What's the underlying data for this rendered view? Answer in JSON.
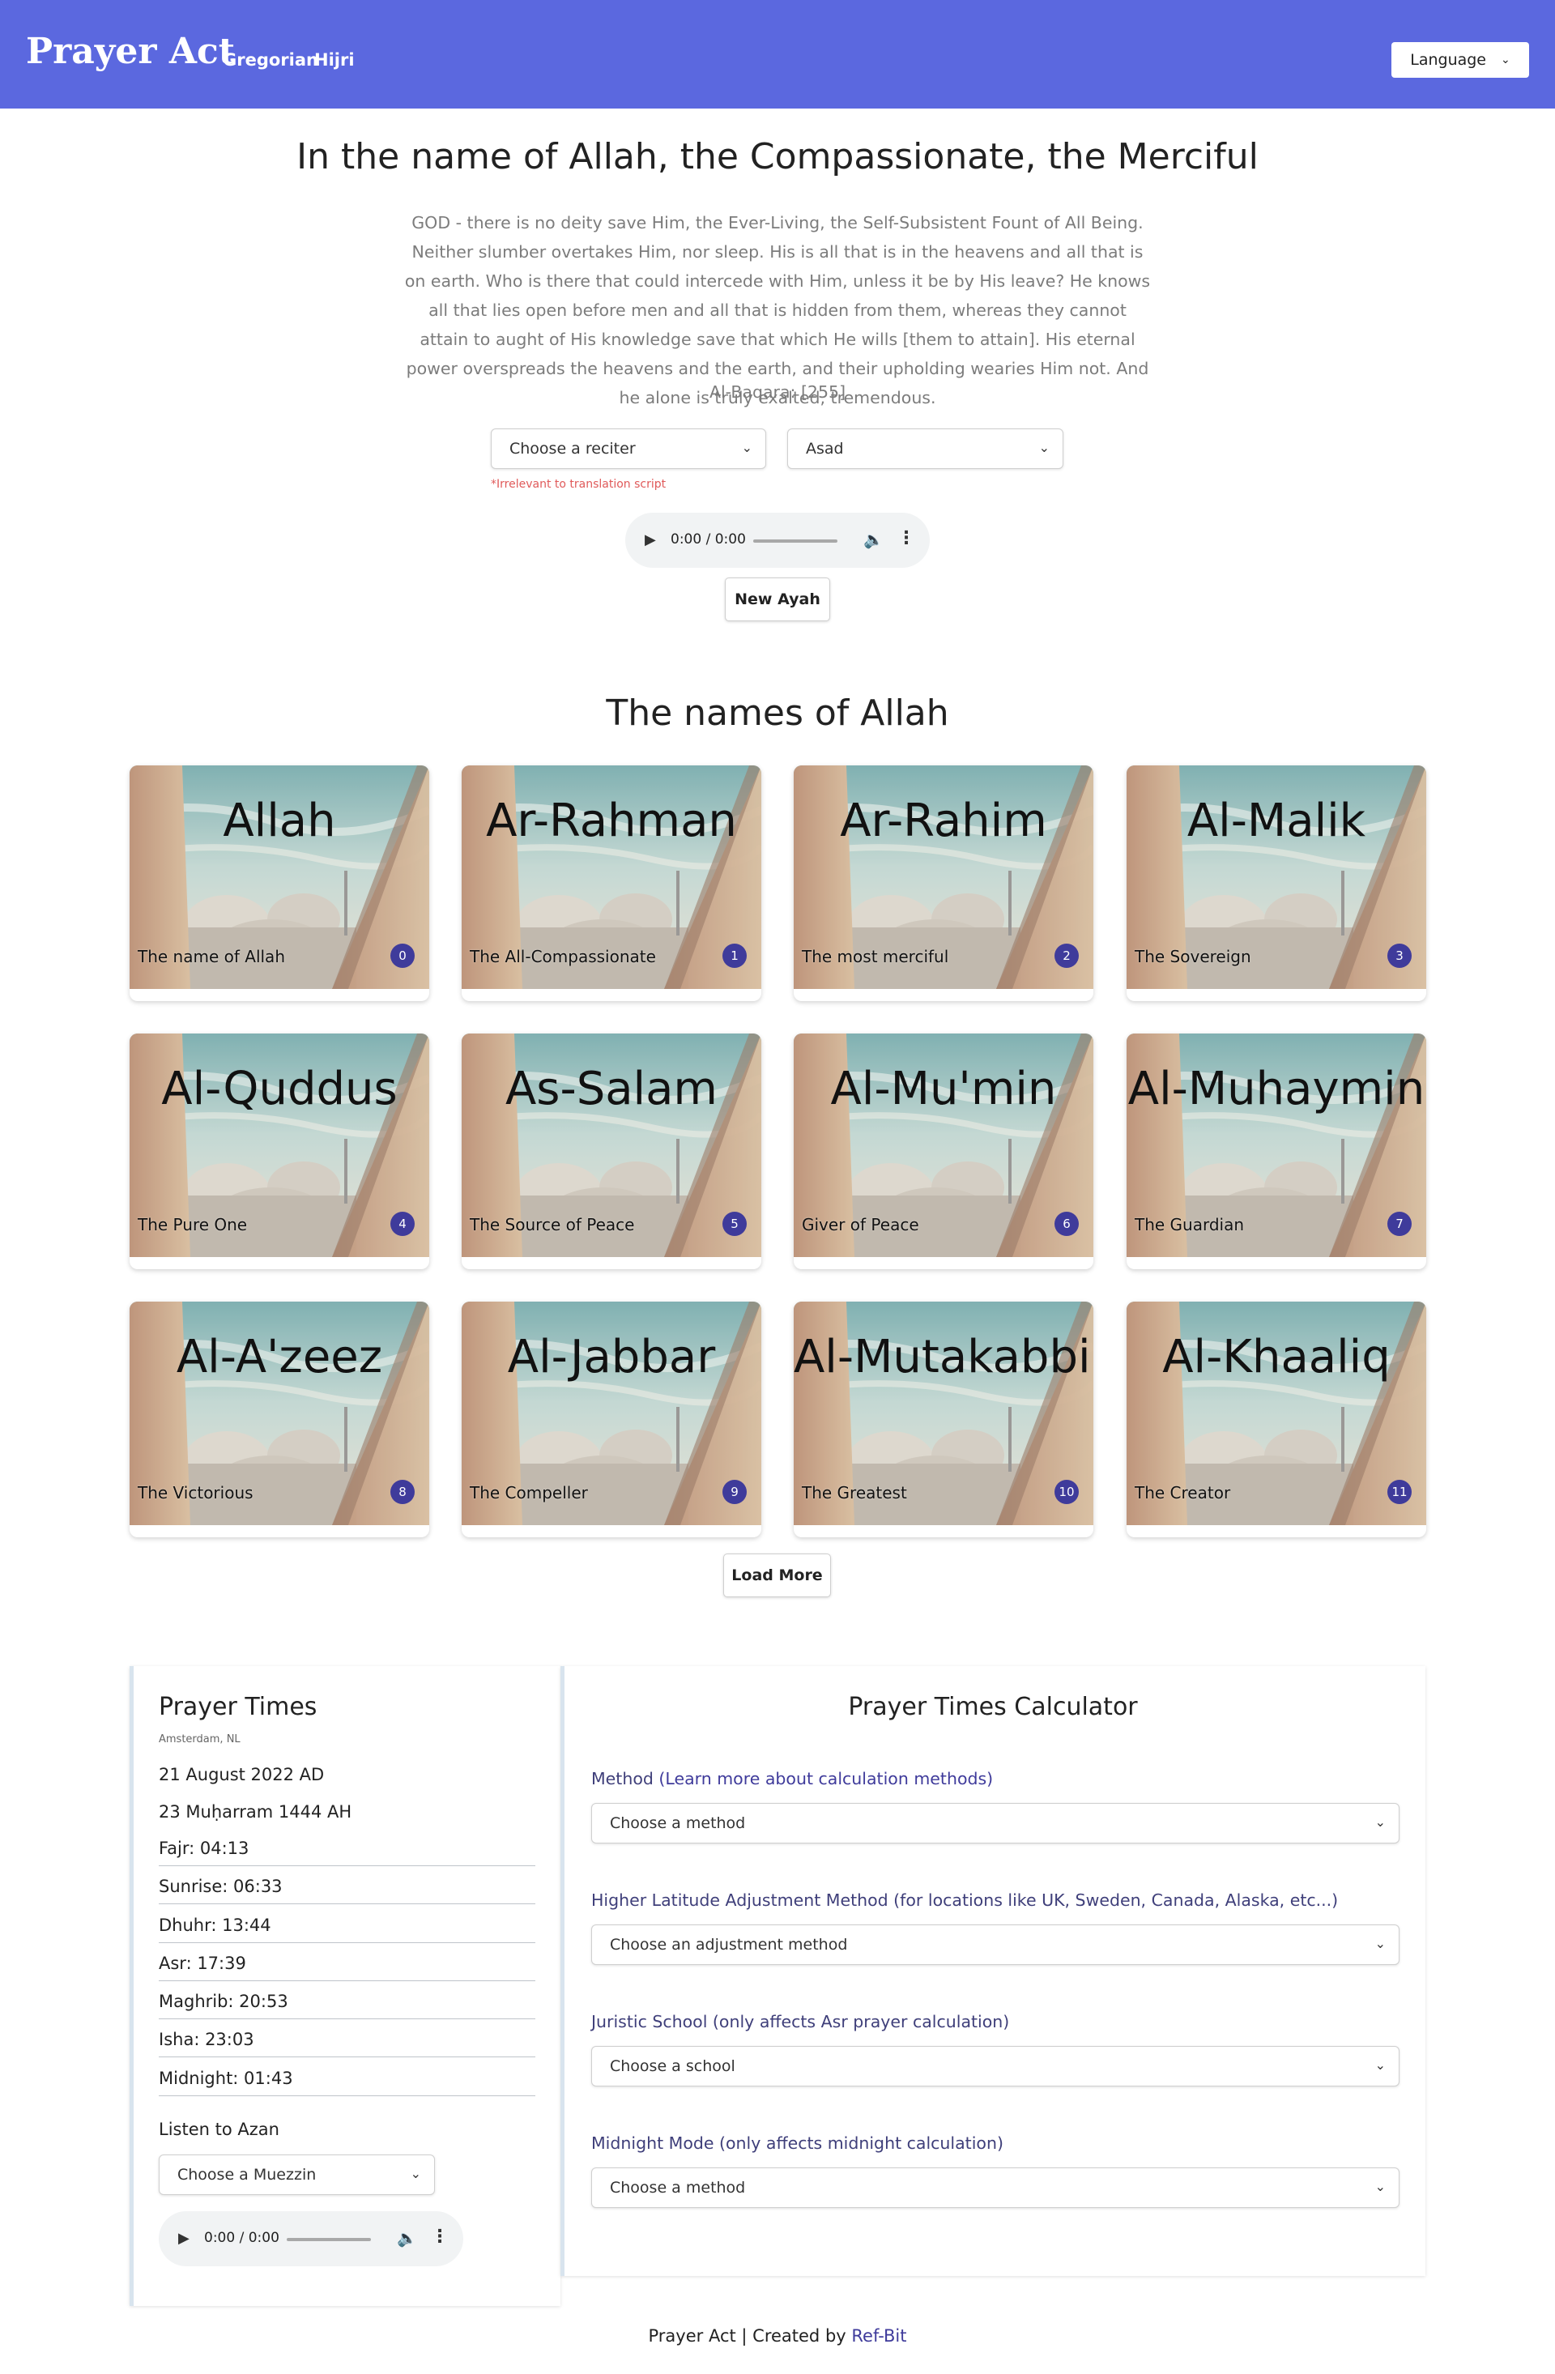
{
  "navbar": {
    "brand": "Prayer Act",
    "links": [
      "Gregorian",
      "Hijri"
    ],
    "language_label": "Language"
  },
  "ayah": {
    "title": "In the name of Allah, the Compassionate, the Merciful",
    "text": "GOD - there is no deity save Him, the Ever-Living, the Self-Subsistent Fount of All Being. Neither slumber overtakes Him, nor sleep. His is all that is in the heavens and all that is on earth. Who is there that could intercede with Him, unless it be by His leave? He knows all that lies open before men and all that is hidden from them, whereas they cannot attain to aught of His knowledge save that which He wills [them to attain]. His eternal power overspreads the heavens and the earth, and their upholding wearies Him not. And he alone is truly exalted, tremendous.",
    "reference": "Al-Baqara: [255]",
    "reciter_select": "Choose a reciter",
    "translation_select": "Asad",
    "reciter_note": "*Irrelevant to translation script",
    "audio_time": "0:00 / 0:00",
    "new_ayah_button": "New Ayah"
  },
  "names": {
    "title": "The names of Allah",
    "cards": [
      {
        "arabic": "Allah",
        "meaning": "The name of Allah",
        "number": "0"
      },
      {
        "arabic": "Ar-Rahman",
        "meaning": "The All-Compassionate",
        "number": "1"
      },
      {
        "arabic": "Ar-Rahim",
        "meaning": "The most merciful",
        "number": "2"
      },
      {
        "arabic": "Al-Malik",
        "meaning": "The Sovereign",
        "number": "3"
      },
      {
        "arabic": "Al-Quddus",
        "meaning": "The Pure One",
        "number": "4"
      },
      {
        "arabic": "As-Salam",
        "meaning": "The Source of Peace",
        "number": "5"
      },
      {
        "arabic": "Al-Mu'min",
        "meaning": "Giver of Peace",
        "number": "6"
      },
      {
        "arabic": "Al-Muhaymin",
        "meaning": "The Guardian",
        "number": "7"
      },
      {
        "arabic": "Al-A'zeez",
        "meaning": "The Victorious",
        "number": "8"
      },
      {
        "arabic": "Al-Jabbar",
        "meaning": "The Compeller",
        "number": "9"
      },
      {
        "arabic": "Al-Mutakabbir",
        "meaning": "The Greatest",
        "number": "10"
      },
      {
        "arabic": "Al-Khaaliq",
        "meaning": "The Creator",
        "number": "11"
      }
    ],
    "load_more_button": "Load More"
  },
  "prayer_times": {
    "title": "Prayer Times",
    "location": "Amsterdam, NL",
    "gregorian_date": "21 August 2022 AD",
    "hijri_date": "23 Muḥarram 1444 AH",
    "rows": [
      "Fajr: 04:13",
      "Sunrise: 06:33",
      "Dhuhr: 13:44",
      "Asr: 17:39",
      "Maghrib: 20:53",
      "Isha: 23:03",
      "Midnight: 01:43"
    ],
    "listen_label": "Listen to Azan",
    "muezzin_select": "Choose a Muezzin",
    "audio_time": "0:00 / 0:00"
  },
  "calculator": {
    "title": "Prayer Times Calculator",
    "method_label": "Method ",
    "method_link": "(Learn more about calculation methods)",
    "method_select": "Choose a method",
    "latitude_label": "Higher Latitude Adjustment Method (for locations like UK, Sweden, Canada, Alaska, etc...)",
    "latitude_select": "Choose an adjustment method",
    "school_label": "Juristic School (only affects Asr prayer calculation)",
    "school_select": "Choose a school",
    "midnight_label": "Midnight Mode (only affects midnight calculation)",
    "midnight_select": "Choose a method"
  },
  "footer": {
    "text": "Prayer Act | Created by ",
    "link": "Ref-Bit"
  },
  "colors": {
    "navbar": "#5b68df",
    "badge": "#3f3b9b",
    "note": "#e05a5a"
  }
}
